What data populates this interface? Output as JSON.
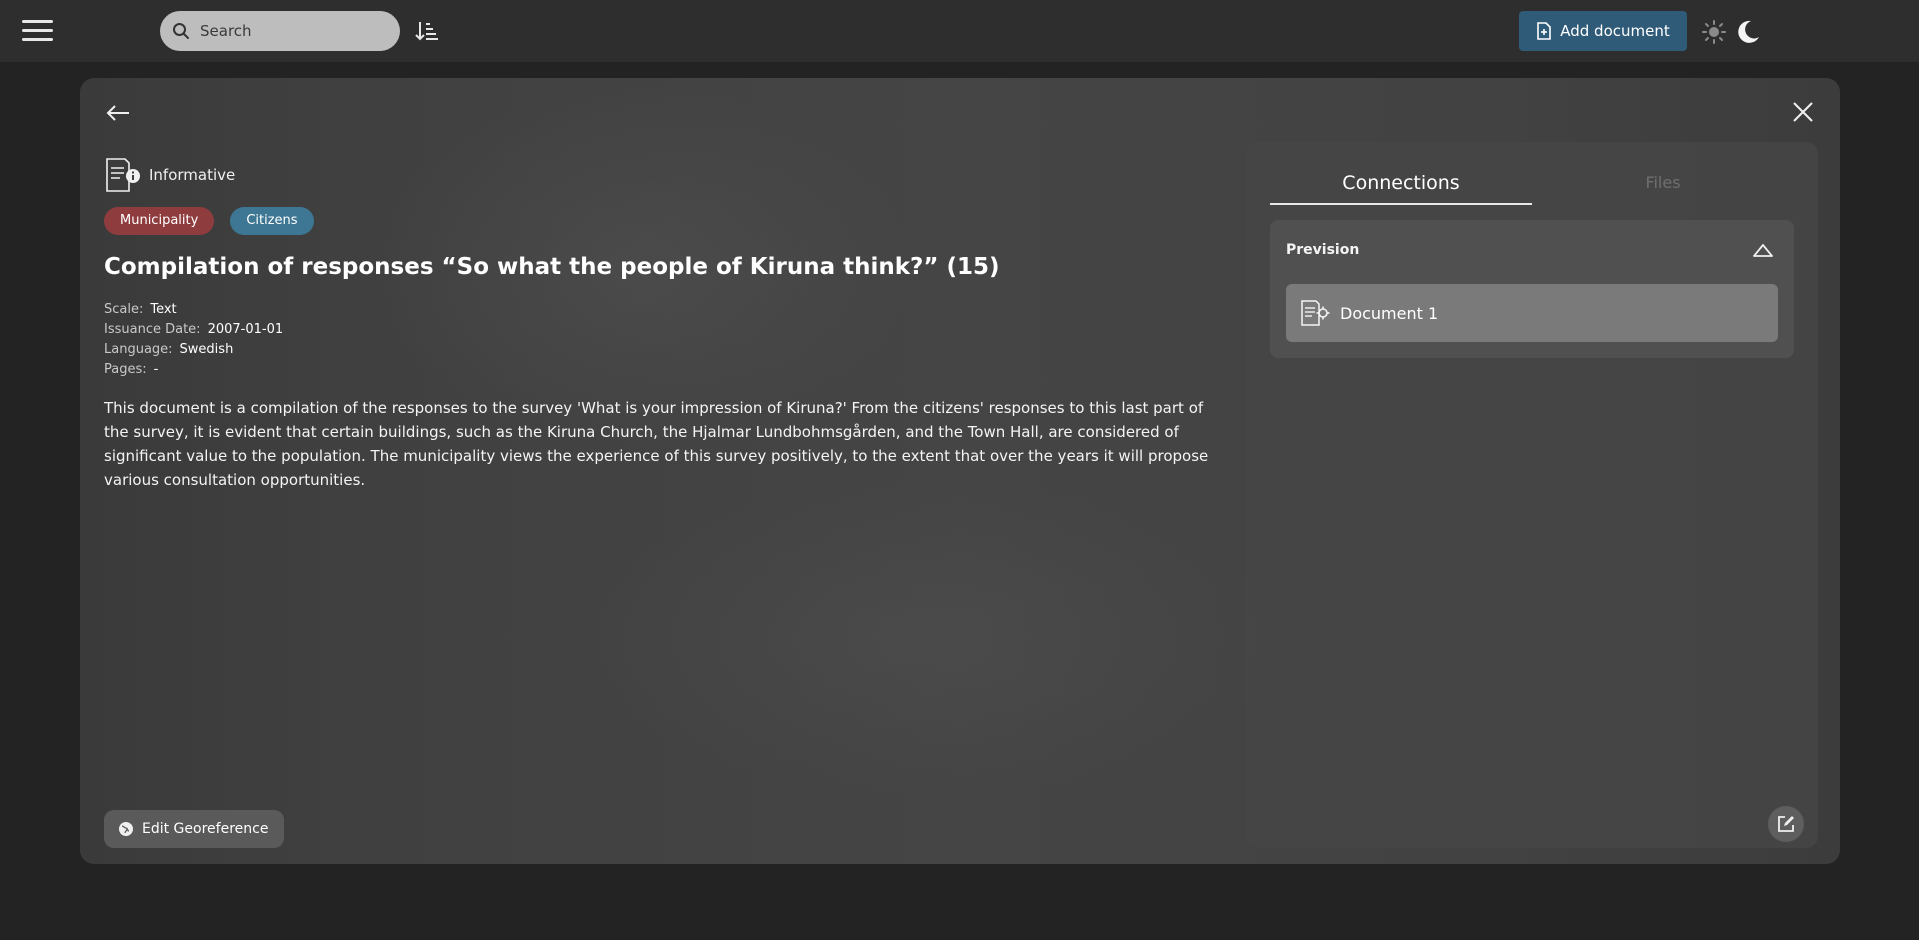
{
  "header": {
    "search_placeholder": "Search",
    "add_document_label": "Add document"
  },
  "document": {
    "type_label": "Informative",
    "tags": [
      {
        "label": "Municipality",
        "color": "#8f3c3e"
      },
      {
        "label": "Citizens",
        "color": "#3e7794"
      }
    ],
    "title": "Compilation of responses “So what the people of Kiruna think?” (15)",
    "meta": [
      {
        "key": "Scale:",
        "value": "Text"
      },
      {
        "key": "Issuance Date:",
        "value": "2007-01-01"
      },
      {
        "key": "Language:",
        "value": "Swedish"
      },
      {
        "key": "Pages:",
        "value": "-"
      }
    ],
    "description": "This document is a compilation of the responses to the survey 'What is your impression of Kiruna?' From the citizens' responses to this last part of the survey, it is evident that certain buildings, such as the Kiruna Church, the Hjalmar Lundbohmsgården, and the Town Hall, are considered of significant value to the population. The municipality views the experience of this survey positively, to the extent that over the years it will propose various consultation opportunities.",
    "edit_georeference_label": "Edit Georeference"
  },
  "panel": {
    "tabs": [
      {
        "label": "Connections",
        "active": true
      },
      {
        "label": "Files",
        "active": false
      }
    ],
    "sections": [
      {
        "heading": "Prevision",
        "items": [
          {
            "name": "Document 1"
          }
        ]
      }
    ]
  },
  "colors": {
    "accent": "#2f5b78",
    "background": "#232323",
    "topbar": "#2e2e2e"
  },
  "icons": [
    "menu-icon",
    "search-icon",
    "sort-icon",
    "file-add-icon",
    "sun-icon",
    "moon-icon",
    "back-arrow-icon",
    "close-icon",
    "informative-document-icon",
    "globe-icon",
    "chevron-up-icon",
    "prescriptive-document-icon",
    "edit-icon"
  ]
}
